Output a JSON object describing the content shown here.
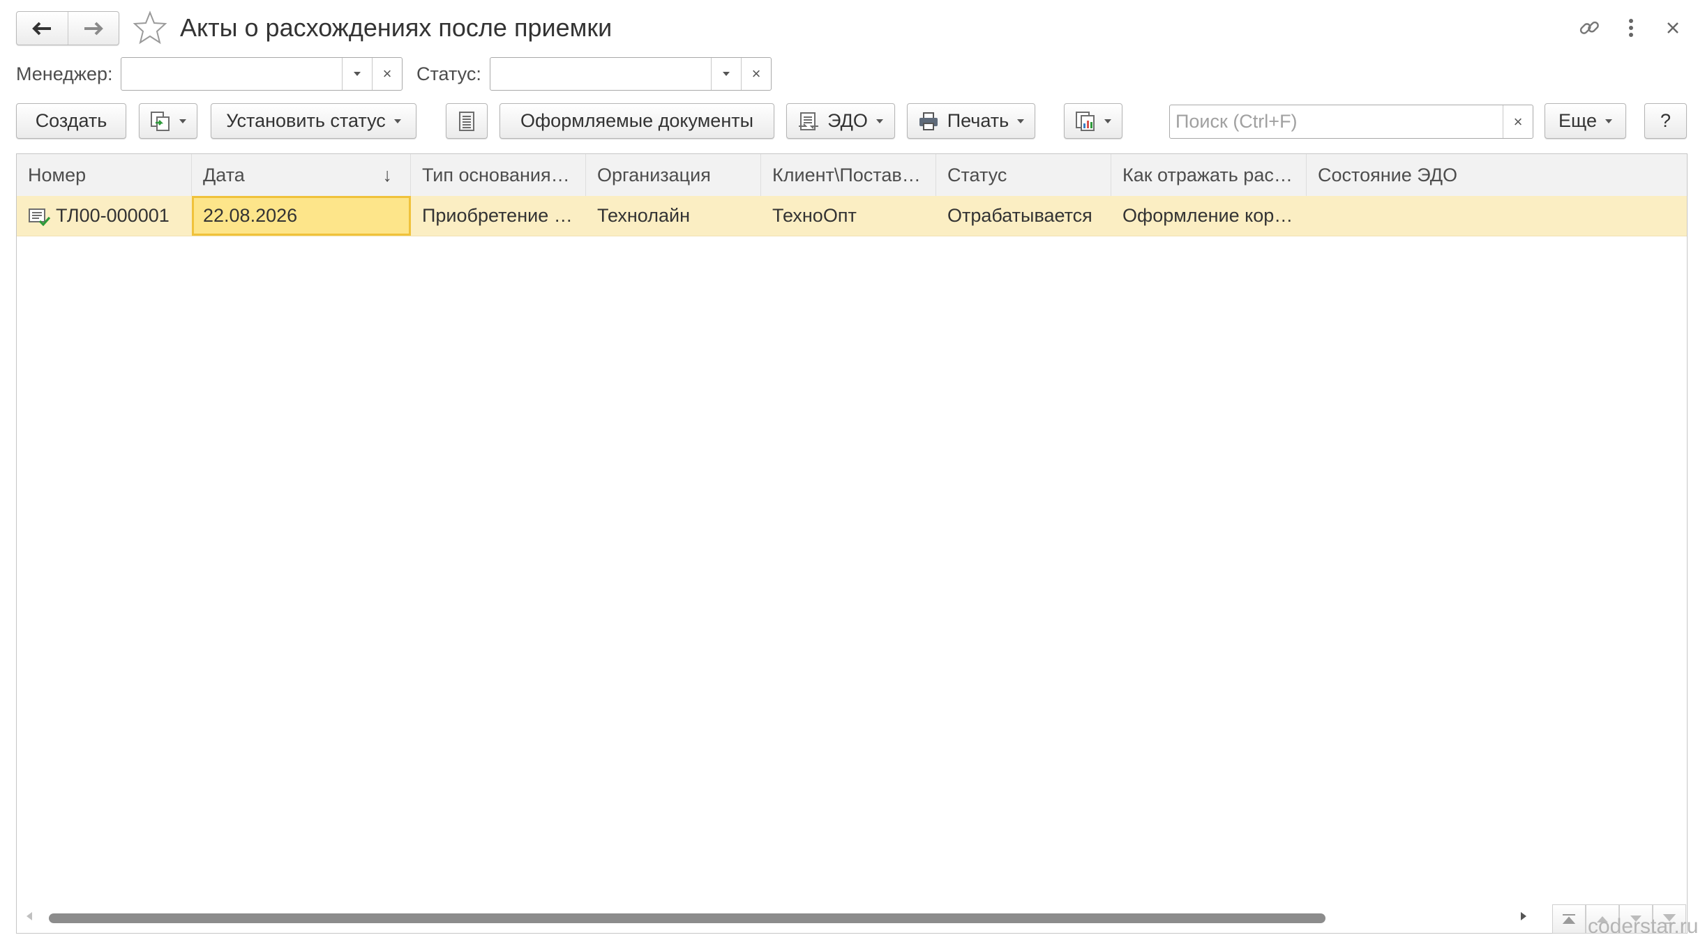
{
  "header": {
    "title": "Акты о расхождениях после приемки",
    "back_icon": "arrow-left-icon",
    "forward_icon": "arrow-right-icon",
    "favorite_icon": "star-icon",
    "link_icon": "link-icon",
    "menu_icon": "kebab-menu-icon",
    "close_icon": "close-icon"
  },
  "filters": {
    "manager_label": "Менеджер:",
    "manager_value": "",
    "status_label": "Статус:",
    "status_value": ""
  },
  "toolbar": {
    "create_label": "Создать",
    "set_status_label": "Установить статус",
    "documents_label": "Оформляемые документы",
    "edo_label": "ЭДО",
    "print_label": "Печать",
    "search_placeholder": "Поиск (Ctrl+F)",
    "more_label": "Еще",
    "help_label": "?"
  },
  "table": {
    "columns": [
      "Номер",
      "Дата",
      "Тип основания…",
      "Организация",
      "Клиент\\Постав…",
      "Статус",
      "Как отражать рас…",
      "Состояние ЭДО"
    ],
    "sort_indicator": "↓",
    "rows": [
      {
        "cells": [
          "ТЛ00-000001",
          "22.08.2026",
          "Приобретение …",
          "Технолайн",
          "ТехноОпт",
          "Отрабатывается",
          "Оформление кор…",
          ""
        ]
      }
    ]
  },
  "watermark": "coderstar.ru",
  "colors": {
    "selected_row": "#fbeec3",
    "selected_cell": "#fde58a",
    "selected_cell_border": "#f0c23b",
    "header_bg": "#f2f2f2",
    "doc_icon_check": "#2e9a3a"
  }
}
